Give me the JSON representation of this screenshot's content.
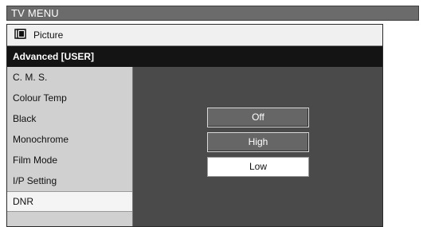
{
  "window": {
    "title": "TV MENU"
  },
  "menu": {
    "category": {
      "label": "Picture",
      "icon": "picture-icon"
    },
    "submenu_header": "Advanced [USER]",
    "items": [
      {
        "label": "C. M. S."
      },
      {
        "label": "Colour Temp"
      },
      {
        "label": "Black"
      },
      {
        "label": "Monochrome"
      },
      {
        "label": "Film Mode"
      },
      {
        "label": "I/P Setting"
      },
      {
        "label": "DNR"
      }
    ],
    "selected_item": "DNR"
  },
  "options": {
    "items": [
      {
        "label": "Off"
      },
      {
        "label": "High"
      },
      {
        "label": "Low"
      }
    ],
    "selected": "Low"
  },
  "colors": {
    "title_bar": "#6b6b6b",
    "panel_background": "#4a4a4a",
    "header_background": "#141414",
    "sidebar_background": "#d0d0d0",
    "selected_background": "#ffffff"
  }
}
